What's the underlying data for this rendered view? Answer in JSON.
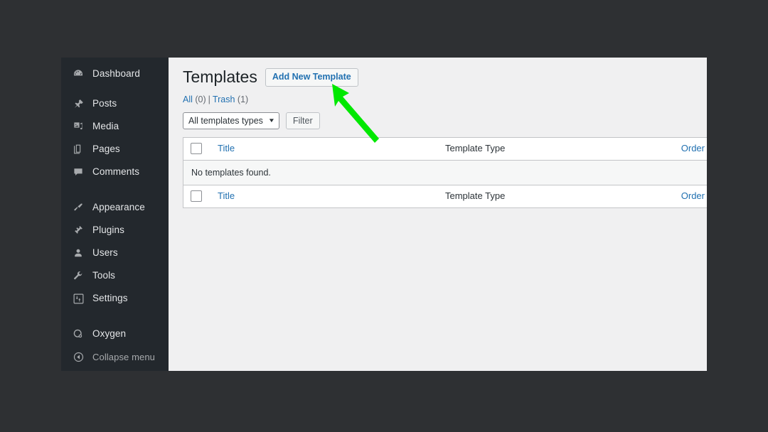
{
  "window": {
    "background_color": "#2e3033",
    "content_background": "#f0f0f1"
  },
  "sidebar": {
    "background_color": "#23282d",
    "items": [
      {
        "label": "Dashboard",
        "icon": "dashboard-icon"
      },
      {
        "label": "Posts",
        "icon": "pin-icon"
      },
      {
        "label": "Media",
        "icon": "media-icon"
      },
      {
        "label": "Pages",
        "icon": "page-icon"
      },
      {
        "label": "Comments",
        "icon": "comment-icon"
      },
      {
        "label": "Appearance",
        "icon": "paintbrush-icon"
      },
      {
        "label": "Plugins",
        "icon": "plug-icon"
      },
      {
        "label": "Users",
        "icon": "user-icon"
      },
      {
        "label": "Tools",
        "icon": "wrench-icon"
      },
      {
        "label": "Settings",
        "icon": "settings-sliders-icon"
      },
      {
        "label": "Oxygen",
        "icon": "oxygen-icon"
      },
      {
        "label": "Collapse menu",
        "icon": "collapse-arrow-icon"
      }
    ]
  },
  "page": {
    "title": "Templates",
    "add_new_label": "Add New Template"
  },
  "views": {
    "all_label": "All",
    "all_count": "(0)",
    "separator": "|",
    "trash_label": "Trash",
    "trash_count": "(1)"
  },
  "filters": {
    "type_select_value": "All templates types",
    "caret": "▼",
    "filter_button_label": "Filter"
  },
  "table": {
    "columns": {
      "title": "Title",
      "template_type": "Template Type",
      "order": "Order"
    },
    "empty_message": "No templates found.",
    "rows": []
  },
  "annotation": {
    "type": "arrow",
    "color": "#00e800",
    "points_to": "Add New Template"
  }
}
